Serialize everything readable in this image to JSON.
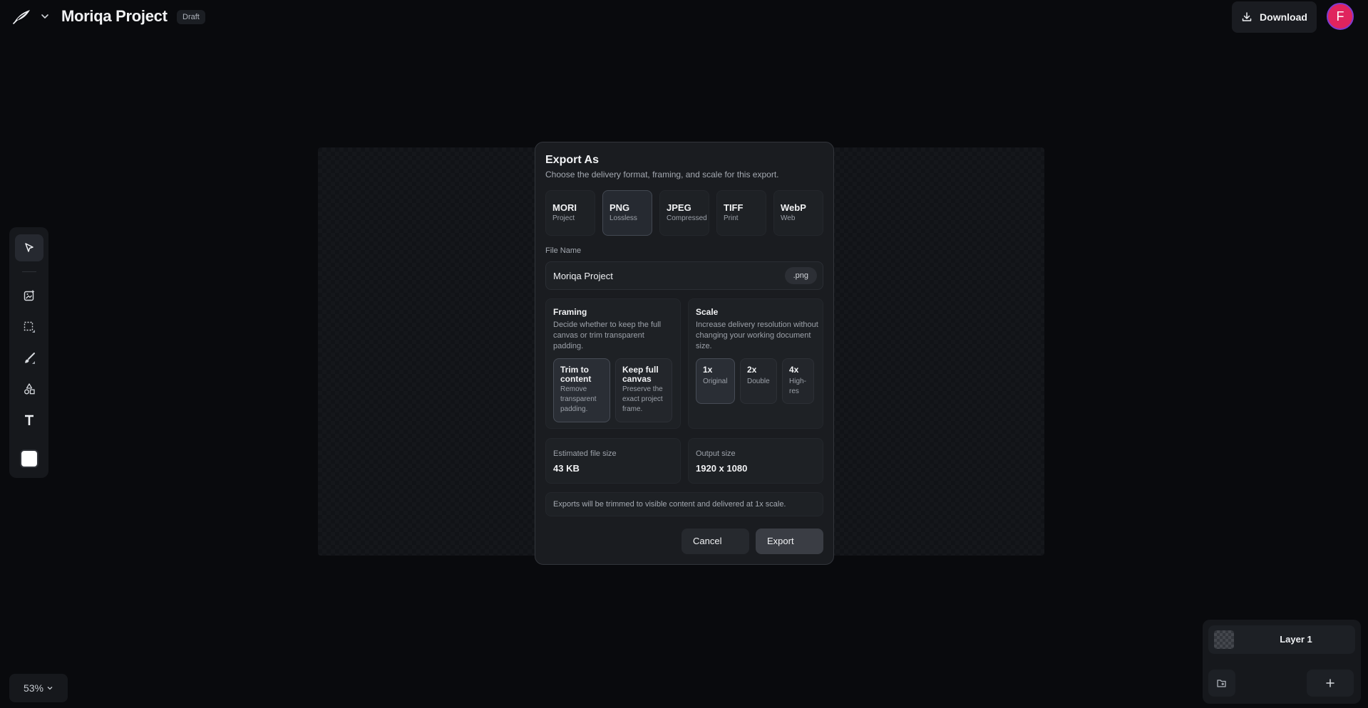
{
  "app": {
    "project_title": "Moriqa Project",
    "status_badge": "Draft",
    "download_label": "Download",
    "avatar_initial": "F",
    "zoom": "53%"
  },
  "layers": {
    "items": [
      {
        "label": "Layer 1"
      }
    ]
  },
  "dialog": {
    "title": "Export As",
    "subtitle": "Choose the delivery format, framing, and scale for this export.",
    "formats": [
      {
        "name": "MORI",
        "desc": "Project",
        "selected": false
      },
      {
        "name": "PNG",
        "desc": "Lossless",
        "selected": true
      },
      {
        "name": "JPEG",
        "desc": "Compressed",
        "selected": false
      },
      {
        "name": "TIFF",
        "desc": "Print",
        "selected": false
      },
      {
        "name": "WebP",
        "desc": "Web",
        "selected": false
      }
    ],
    "file_name_label": "File Name",
    "file_name_value": "Moriqa Project",
    "extension": ".png",
    "framing": {
      "title": "Framing",
      "desc": "Decide whether to keep the full canvas or trim transparent padding.",
      "options": [
        {
          "name": "Trim to content",
          "desc": "Remove transparent padding.",
          "selected": true
        },
        {
          "name": "Keep full canvas",
          "desc": "Preserve the exact project frame.",
          "selected": false
        }
      ]
    },
    "scale": {
      "title": "Scale",
      "desc": "Increase delivery resolution without changing your working document size.",
      "options": [
        {
          "name": "1x",
          "desc": "Original",
          "selected": true
        },
        {
          "name": "2x",
          "desc": "Double",
          "selected": false
        },
        {
          "name": "4x",
          "desc": "High-res",
          "selected": false
        }
      ]
    },
    "estimated_label": "Estimated file size",
    "estimated_value": "43 KB",
    "output_label": "Output size",
    "output_value": "1920 x 1080",
    "note": "Exports will be trimmed to visible content and delivered at 1x scale.",
    "cancel_label": "Cancel",
    "export_label": "Export"
  },
  "colors": {
    "background": "#090a0d",
    "panel": "#16181c",
    "avatar": "#e0245e",
    "avatar_ring": "#7e3bd0"
  }
}
